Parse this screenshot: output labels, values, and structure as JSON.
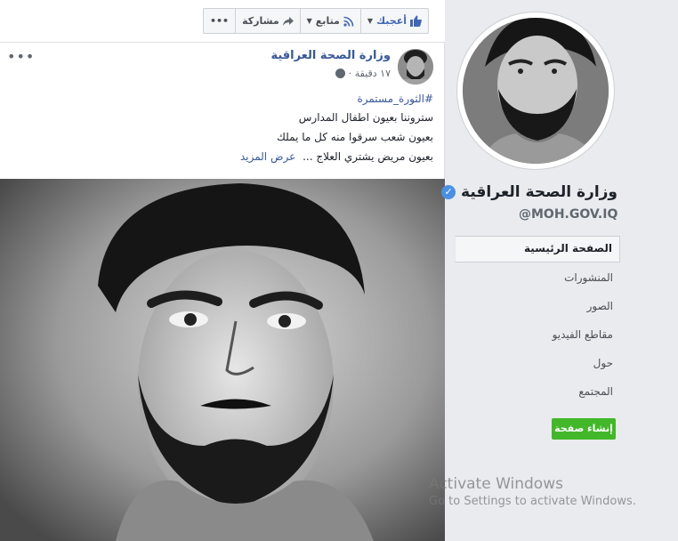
{
  "actions": {
    "like_label": "أعجبك",
    "follow_label": "متابع",
    "share_label": "مشاركة",
    "more_label": "•••"
  },
  "post": {
    "author": "وزارة الصحة العراقية",
    "time": "١٧ دقيقة ·",
    "hashtag": "#الثورة_مستمرة",
    "line1": "ستروننا بعيون اطفال المدارس",
    "line2": "بعيون شعب سرقوا منه كل ما يملك",
    "line3": "بعيون مريض يشتري العلاج ...",
    "see_more": "عرض المزيد",
    "menu_dots": "•••"
  },
  "page": {
    "name": "وزارة الصحة العراقية",
    "handle": "@MOH.GOV.IQ"
  },
  "nav": {
    "items": [
      {
        "label": "الصفحة الرئيسية"
      },
      {
        "label": "المنشورات"
      },
      {
        "label": "الصور"
      },
      {
        "label": "مقاطع الفيديو"
      },
      {
        "label": "حول"
      },
      {
        "label": "المجتمع"
      }
    ]
  },
  "create_page_label": "إنشاء صفحة",
  "watermark": {
    "title": "Activate Windows",
    "subtitle": "Go to Settings to activate Windows."
  },
  "colors": {
    "link": "#385898",
    "like": "#4267b2",
    "create_button": "#42b72a"
  }
}
